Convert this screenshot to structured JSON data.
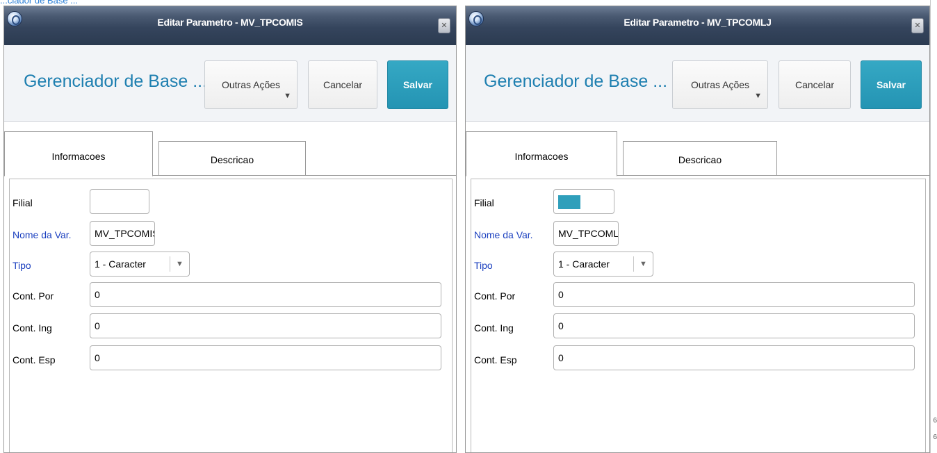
{
  "background": {
    "top_text": "...ciador de Base ...",
    "edge_marks": [
      "6",
      "6"
    ]
  },
  "dialogs": [
    {
      "window_title": "Editar Parametro - MV_TPCOMIS",
      "app_title": "Gerenciador de Base ...",
      "buttons": {
        "outras": "Outras Ações",
        "cancelar": "Cancelar",
        "salvar": "Salvar"
      },
      "tabs": {
        "informacoes": "Informacoes",
        "descricao": "Descricao"
      },
      "form": {
        "filial_label": "Filial",
        "filial_value": "",
        "nome_label": "Nome da Var.",
        "nome_value": "MV_TPCOMIS",
        "tipo_label": "Tipo",
        "tipo_value": "1 - Caracter",
        "por_label": "Cont. Por",
        "por_value": "0",
        "ing_label": "Cont. Ing",
        "ing_value": "0",
        "esp_label": "Cont. Esp",
        "esp_value": "0"
      }
    },
    {
      "window_title": "Editar Parametro - MV_TPCOMLJ",
      "app_title": "Gerenciador de Base ...",
      "buttons": {
        "outras": "Outras Ações",
        "cancelar": "Cancelar",
        "salvar": "Salvar"
      },
      "tabs": {
        "informacoes": "Informacoes",
        "descricao": "Descricao"
      },
      "form": {
        "filial_label": "Filial",
        "filial_value": "",
        "nome_label": "Nome da Var.",
        "nome_value": "MV_TPCOML",
        "tipo_label": "Tipo",
        "tipo_value": "1 - Caracter",
        "por_label": "Cont. Por",
        "por_value": "0",
        "ing_label": "Cont. Ing",
        "ing_value": "0",
        "esp_label": "Cont. Esp",
        "esp_value": "0"
      }
    }
  ],
  "colors": {
    "accent": "#2494b3",
    "title_blue": "#1e7fb0",
    "label_blue": "#1a3fbf",
    "filial_swatch": "#2f9fbb"
  },
  "icons": {
    "window_logo": "totvs-logo-icon",
    "close": "close-icon",
    "dropdown": "chevron-down-icon"
  }
}
